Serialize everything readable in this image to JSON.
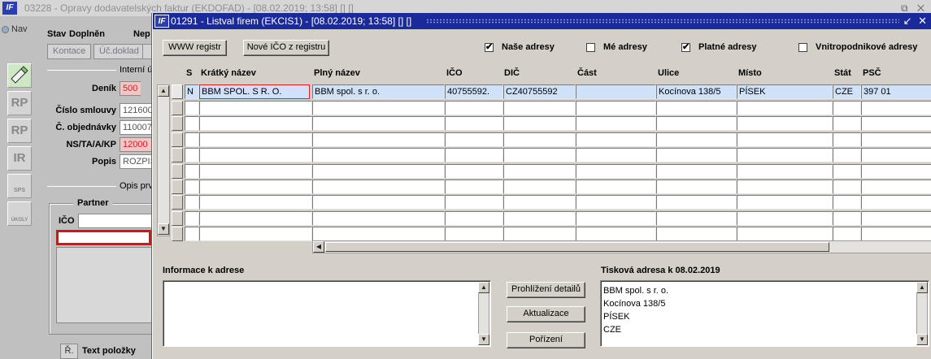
{
  "background_window": {
    "title": "03228 - Opravy dodavatelských faktur (EKDOFAD) - [08.02.2019; 13:58]  []  []",
    "logo": "IF",
    "controls": "⧉ ✕",
    "nav_label": "Nav",
    "side_buttons": [
      "",
      "RP",
      "RP",
      "IR",
      "SPS",
      "ÚKOLY"
    ],
    "header_labels": {
      "stav": "Stav",
      "doplnen": "Doplněn",
      "nep": "Nep"
    },
    "buttons": {
      "kontace": "Kontace",
      "uc_doklad": "Úč.doklad"
    },
    "section_interni": "Interní ú",
    "fields": [
      {
        "label": "Deník",
        "value": "500",
        "style": "pink"
      },
      {
        "label": "Číslo smlouvy",
        "value": "121600"
      },
      {
        "label": "Č. objednávky",
        "value": "110007"
      },
      {
        "label": "NS/TA/A/KP",
        "value": "12000",
        "style": "pink"
      },
      {
        "label": "Popis",
        "value": "ROZPIS"
      }
    ],
    "opis_label": "Opis prv",
    "partner": {
      "title": "Partner",
      "ico_label": "IČO",
      "ico_value": ""
    },
    "text_polozky": {
      "button": "Ř.",
      "label": "Text položky"
    }
  },
  "modal": {
    "title": "01291 - Listval firem (EKCIS1) - [08.02.2019; 13:58]  []  []",
    "logo": "IF",
    "controls": "↙ ✕",
    "buttons": {
      "www_registr": "WWW registr",
      "nove_ico": "Nové IČO z registru",
      "prohlizeni": "Prohlížení detailů",
      "aktualizace": "Aktualizace",
      "porizeni": "Pořízení"
    },
    "checkboxes": [
      {
        "label": "Naše adresy",
        "checked": true
      },
      {
        "label": "Mé adresy",
        "checked": false
      },
      {
        "label": "Platné adresy",
        "checked": true
      },
      {
        "label": "Vnitropodnikové adresy",
        "checked": false
      }
    ],
    "check_mark": "✔",
    "grid": {
      "columns": [
        "S",
        "Krátký název",
        "Plný název",
        "IČO",
        "DIČ",
        "Část",
        "Ulice",
        "Místo",
        "Stát",
        "PSČ"
      ],
      "rows": [
        [
          "N",
          "BBM SPOL. S R. O.",
          "BBM spol. s r. o.",
          "40755592.",
          "CZ40755592",
          "",
          "Kocínova 138/5",
          "PÍSEK",
          "CZE",
          "397 01"
        ]
      ],
      "empty_row_count": 9
    },
    "info_label": "Informace k adrese",
    "print_label": "Tisková adresa k 08.02.2019",
    "print_address": [
      "BBM spol. s r. o.",
      "Kocínova 138/5",
      "PÍSEK",
      "CZE"
    ]
  }
}
